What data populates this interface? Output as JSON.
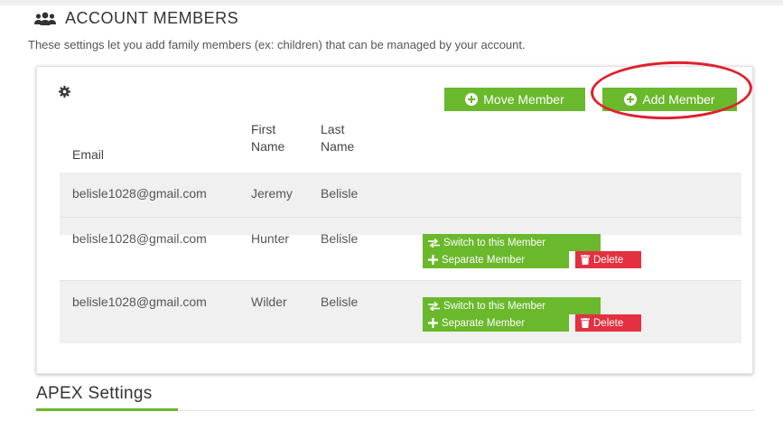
{
  "section": {
    "title": "ACCOUNT MEMBERS",
    "description": "These settings let you add family members (ex: children) that can be managed by your account."
  },
  "toolbar": {
    "move_label": "Move Member",
    "add_label": "Add Member"
  },
  "table": {
    "headers": {
      "email": "Email",
      "first_line1": "First",
      "first_line2": "Name",
      "last_line1": "Last",
      "last_line2": "Name"
    },
    "rows": [
      {
        "email": "belisle1028@gmail.com",
        "first": "Jeremy",
        "last": "Belisle"
      },
      {
        "email": "belisle1028@gmail.com",
        "first": "Hunter",
        "last": "Belisle"
      },
      {
        "email": "belisle1028@gmail.com",
        "first": "Wilder",
        "last": "Belisle"
      }
    ],
    "actions": {
      "switch_label": "Switch to this Member",
      "separate_label": "Separate Member",
      "delete_label": "Delete"
    }
  },
  "apex": {
    "title": "APEX Settings"
  },
  "colors": {
    "accent_green": "#6ab82b",
    "danger_red": "#e4303f",
    "highlight_ring": "#e0202c"
  },
  "icons": {
    "section": "users-icon",
    "settings": "gear-icon",
    "add": "plus-circle-icon",
    "switch": "exchange-icon",
    "separate": "plus-icon",
    "delete": "trash-icon"
  }
}
